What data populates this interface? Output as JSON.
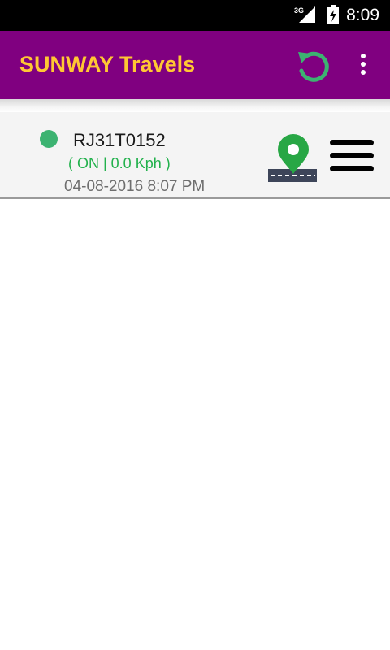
{
  "status_bar": {
    "network": "3G",
    "time": "8:09"
  },
  "app_bar": {
    "title": "SUNWAY Travels",
    "title_color": "#FFC733",
    "background": "#800080"
  },
  "vehicles": [
    {
      "number": "RJ31T0152",
      "status_text": "( ON |  0.0 Kph )",
      "timestamp": "04-08-2016 8:07 PM",
      "status_color": "#3cb371"
    }
  ],
  "icons": {
    "refresh": "refresh-icon",
    "overflow": "more-vert-icon",
    "map": "map-location-icon",
    "menu": "hamburger-menu-icon"
  }
}
